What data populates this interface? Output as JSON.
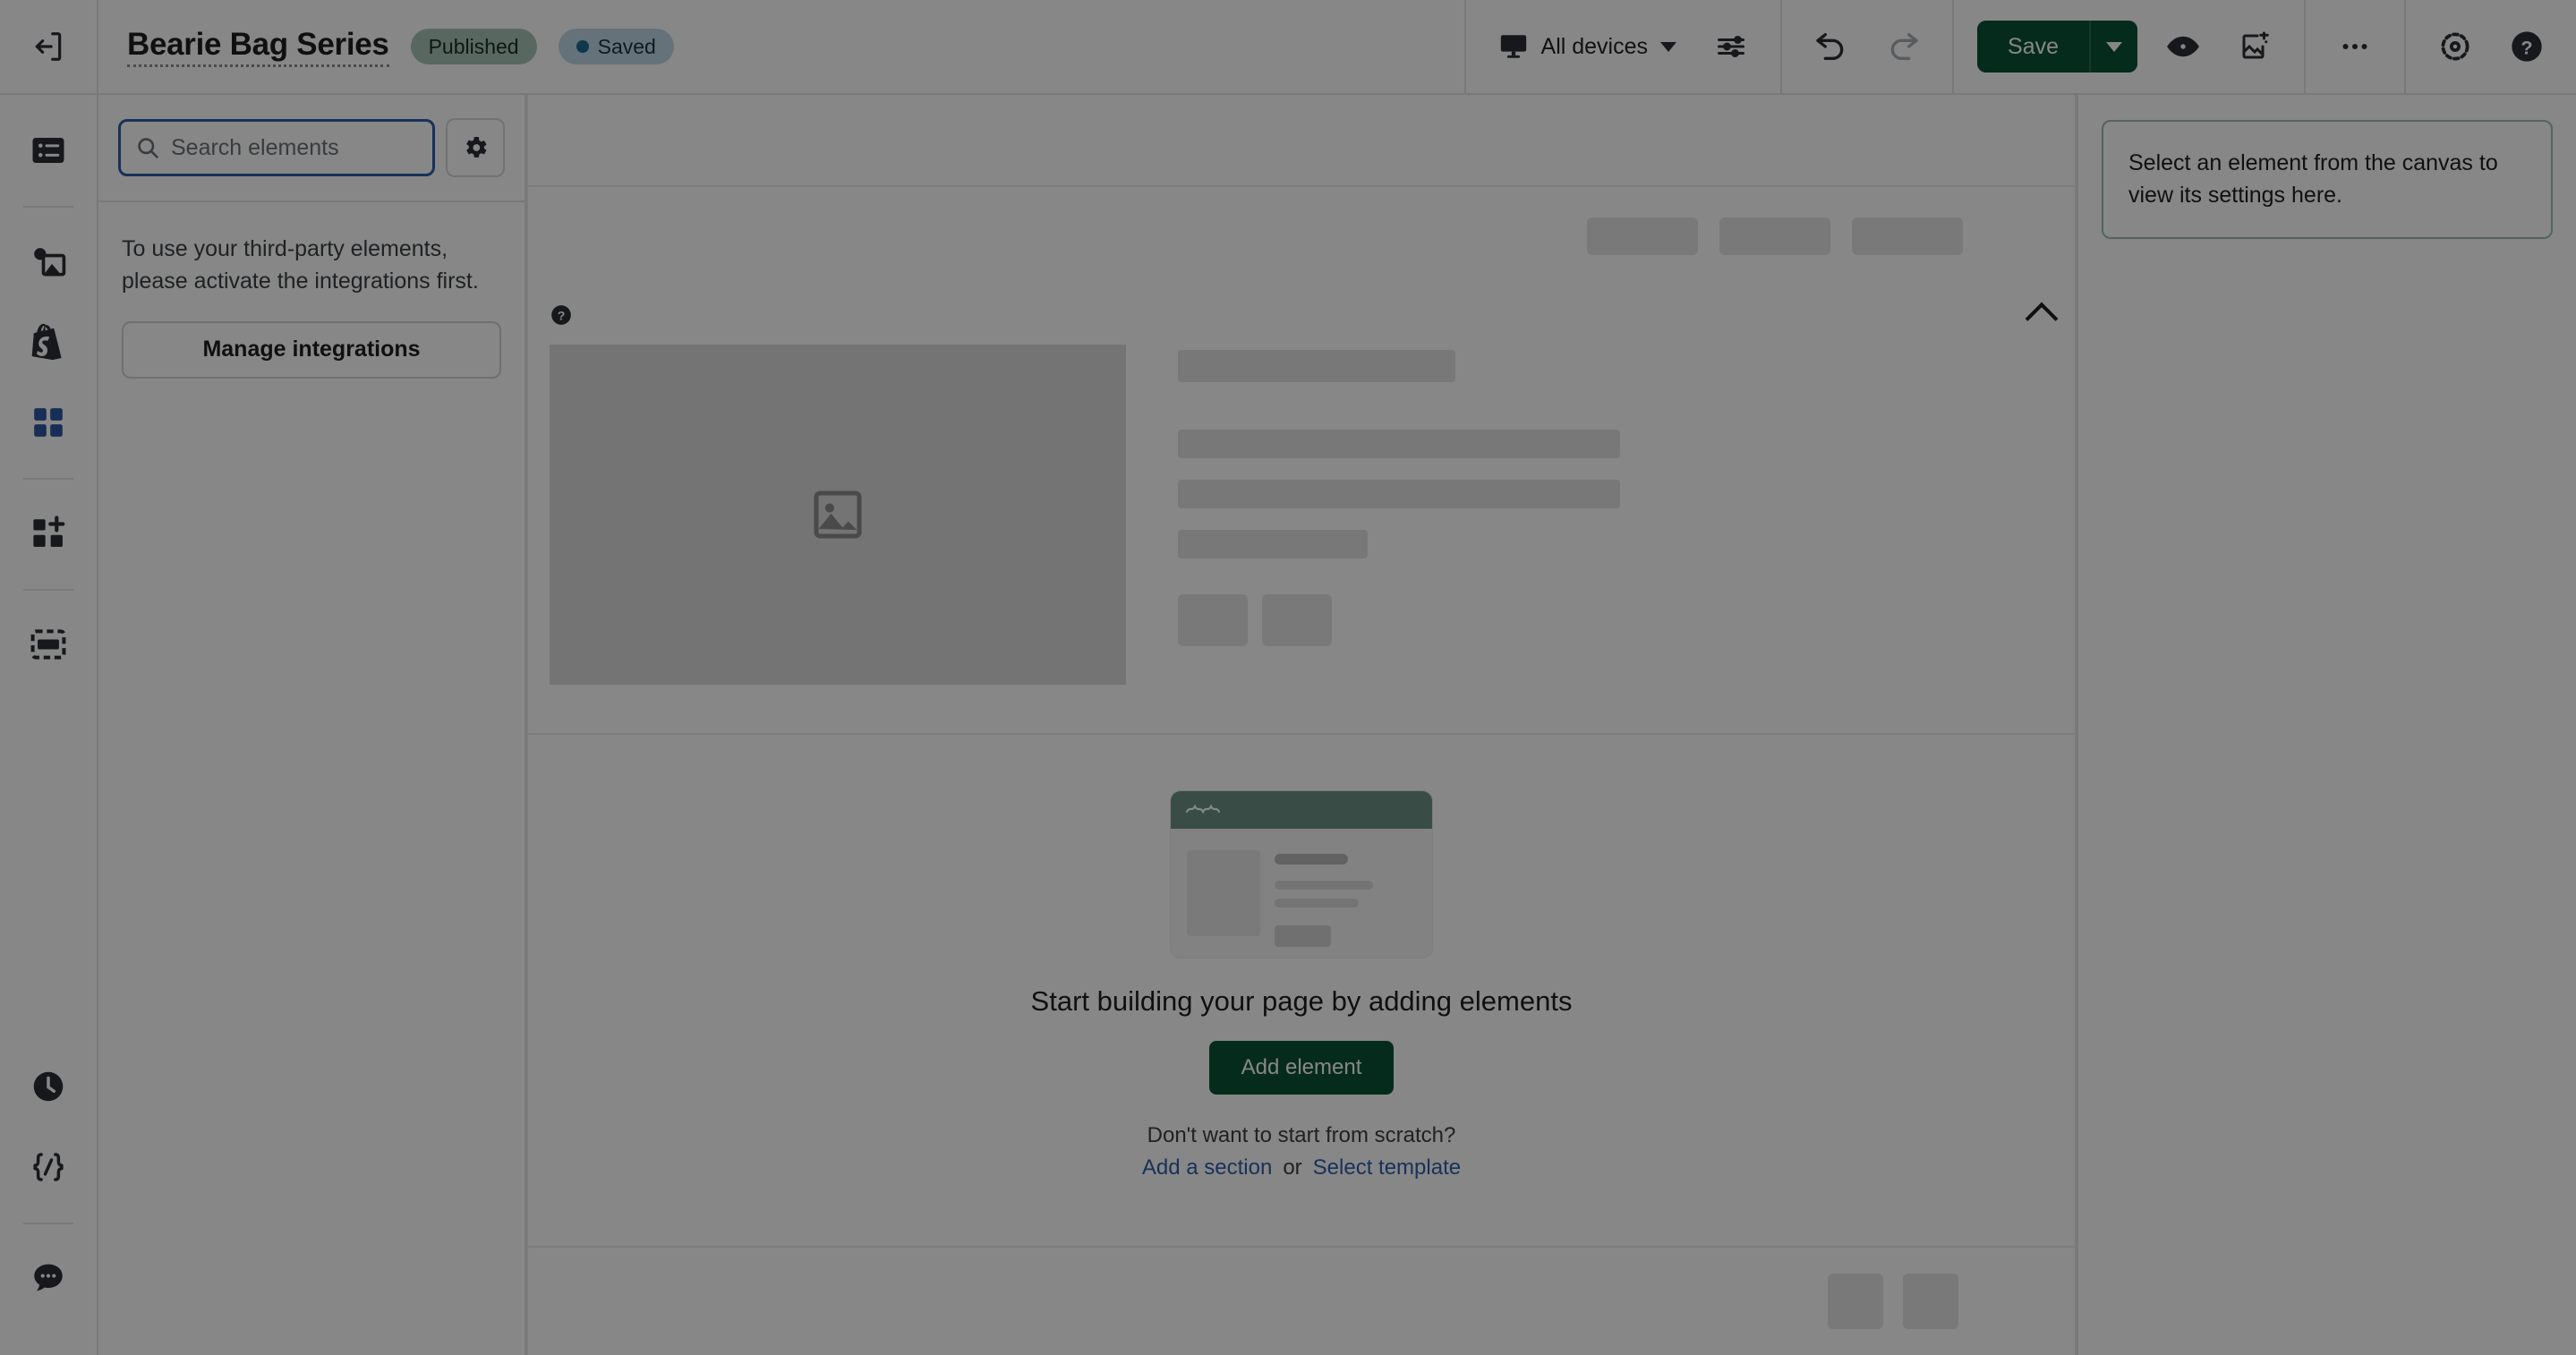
{
  "topbar": {
    "collapse_icon": "collapse-panel-icon",
    "title": "Bearie Bag Series",
    "badges": [
      {
        "label": "Published",
        "type": "published",
        "color": "#a7c4b5"
      },
      {
        "label": "Saved",
        "type": "saved",
        "color": "#bfd7e6",
        "dot_color": "#1b6a8f"
      }
    ],
    "device_selector": {
      "icon": "desktop-monitor-icon",
      "label": "All devices",
      "caret": "chevron-down-icon"
    },
    "tune_icon": "sliders-tune-icon",
    "undo_icon": "undo-arrow-icon",
    "redo_icon": "redo-arrow-icon",
    "save": {
      "label": "Save",
      "caret": "chevron-down-icon",
      "color": "#0b5235"
    },
    "preview_icon": "eye-preview-icon",
    "publish_icon": "publish-image-icon",
    "more_icon": "more-horizontal-icon",
    "settings_icon": "gear-dotted-icon",
    "help_icon": "question-circle-icon"
  },
  "rail": {
    "items": [
      {
        "name": "layers-list",
        "icon": "list-layers-icon",
        "active": false
      },
      {
        "name": "media-library",
        "icon": "image-media-icon",
        "active": false
      },
      {
        "name": "shopify",
        "icon": "shopify-bag-icon",
        "active": false
      },
      {
        "name": "elements",
        "icon": "grid-elements-icon",
        "active": true
      },
      {
        "name": "add-apps",
        "icon": "grid-plus-icon",
        "active": false
      },
      {
        "name": "sections",
        "icon": "section-dashed-icon",
        "active": false
      }
    ],
    "bottom_items": [
      {
        "name": "version-history",
        "icon": "clock-history-icon"
      },
      {
        "name": "custom-code",
        "icon": "code-brackets-icon"
      },
      {
        "name": "chat-support",
        "icon": "chat-bubble-icon"
      }
    ]
  },
  "left_panel": {
    "search": {
      "icon": "search-icon",
      "placeholder": "Search elements",
      "value": ""
    },
    "gear_icon": "gear-icon",
    "message": "To use your third-party elements, please activate the integrations first.",
    "manage_button_label": "Manage integrations"
  },
  "canvas": {
    "section_help_icon": "question-circle-small-icon",
    "section_collapse_icon": "chevron-up-icon",
    "product_image_placeholder_icon": "image-placeholder-icon",
    "empty_state": {
      "illustration": "page-layout-illustration",
      "title": "Start building your page by adding elements",
      "add_element_label": "Add element",
      "scratch_text": "Don't want to start from scratch?",
      "add_section_link": "Add a section",
      "or_text": "or",
      "select_template_link": "Select template"
    }
  },
  "right_panel": {
    "message": "Select an element from the canvas to view its settings here."
  }
}
